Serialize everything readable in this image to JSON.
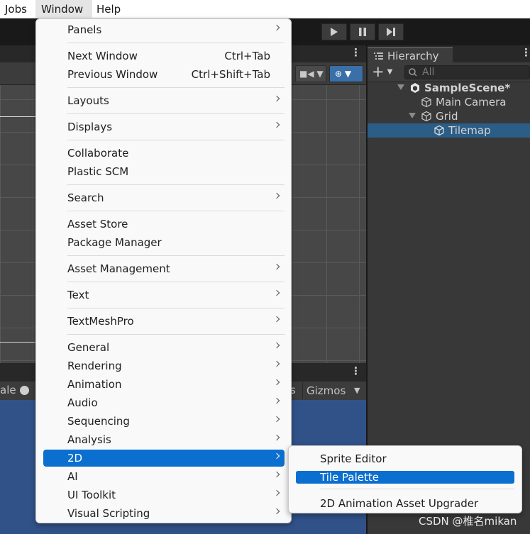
{
  "menubar": {
    "items": [
      "Jobs",
      "Window",
      "Help"
    ]
  },
  "window_menu": {
    "items": [
      {
        "label": "Panels",
        "submenu": true
      },
      {
        "label": "Next Window",
        "shortcut": "Ctrl+Tab"
      },
      {
        "label": "Previous Window",
        "shortcut": "Ctrl+Shift+Tab"
      },
      {
        "label": "Layouts",
        "submenu": true
      },
      {
        "label": "Displays",
        "submenu": true
      },
      {
        "label": "Collaborate"
      },
      {
        "label": "Plastic SCM"
      },
      {
        "label": "Search",
        "submenu": true
      },
      {
        "label": "Asset Store"
      },
      {
        "label": "Package Manager"
      },
      {
        "label": "Asset Management",
        "submenu": true
      },
      {
        "label": "Text",
        "submenu": true
      },
      {
        "label": "TextMeshPro",
        "submenu": true
      },
      {
        "label": "General",
        "submenu": true
      },
      {
        "label": "Rendering",
        "submenu": true
      },
      {
        "label": "Animation",
        "submenu": true
      },
      {
        "label": "Audio",
        "submenu": true
      },
      {
        "label": "Sequencing",
        "submenu": true
      },
      {
        "label": "Analysis",
        "submenu": true
      },
      {
        "label": "2D",
        "submenu": true,
        "highlighted": true
      },
      {
        "label": "AI",
        "submenu": true
      },
      {
        "label": "UI Toolkit",
        "submenu": true
      },
      {
        "label": "Visual Scripting",
        "submenu": true
      }
    ]
  },
  "submenu_2d": {
    "items": [
      {
        "label": "Sprite Editor"
      },
      {
        "label": "Tile Palette",
        "highlighted": true
      },
      {
        "label": "2D Animation Asset Upgrader"
      }
    ]
  },
  "hierarchy": {
    "tab_label": "Hierarchy",
    "add_label": "+",
    "search_placeholder": "All",
    "rows": [
      {
        "label": "SampleScene*",
        "bold": true
      },
      {
        "label": "Main Camera"
      },
      {
        "label": "Grid"
      },
      {
        "label": "Tilemap",
        "selected": true
      }
    ]
  },
  "game_view": {
    "scale_label": "ale",
    "stats_label": "s",
    "gizmos_label": "Gizmos"
  },
  "watermark": "CSDN @椎名mikan",
  "colors": {
    "menu_highlight": "#0b6fd0",
    "selection_row": "#2c5d87",
    "game_view_bg": "#315289",
    "editor_bg": "#383838"
  }
}
